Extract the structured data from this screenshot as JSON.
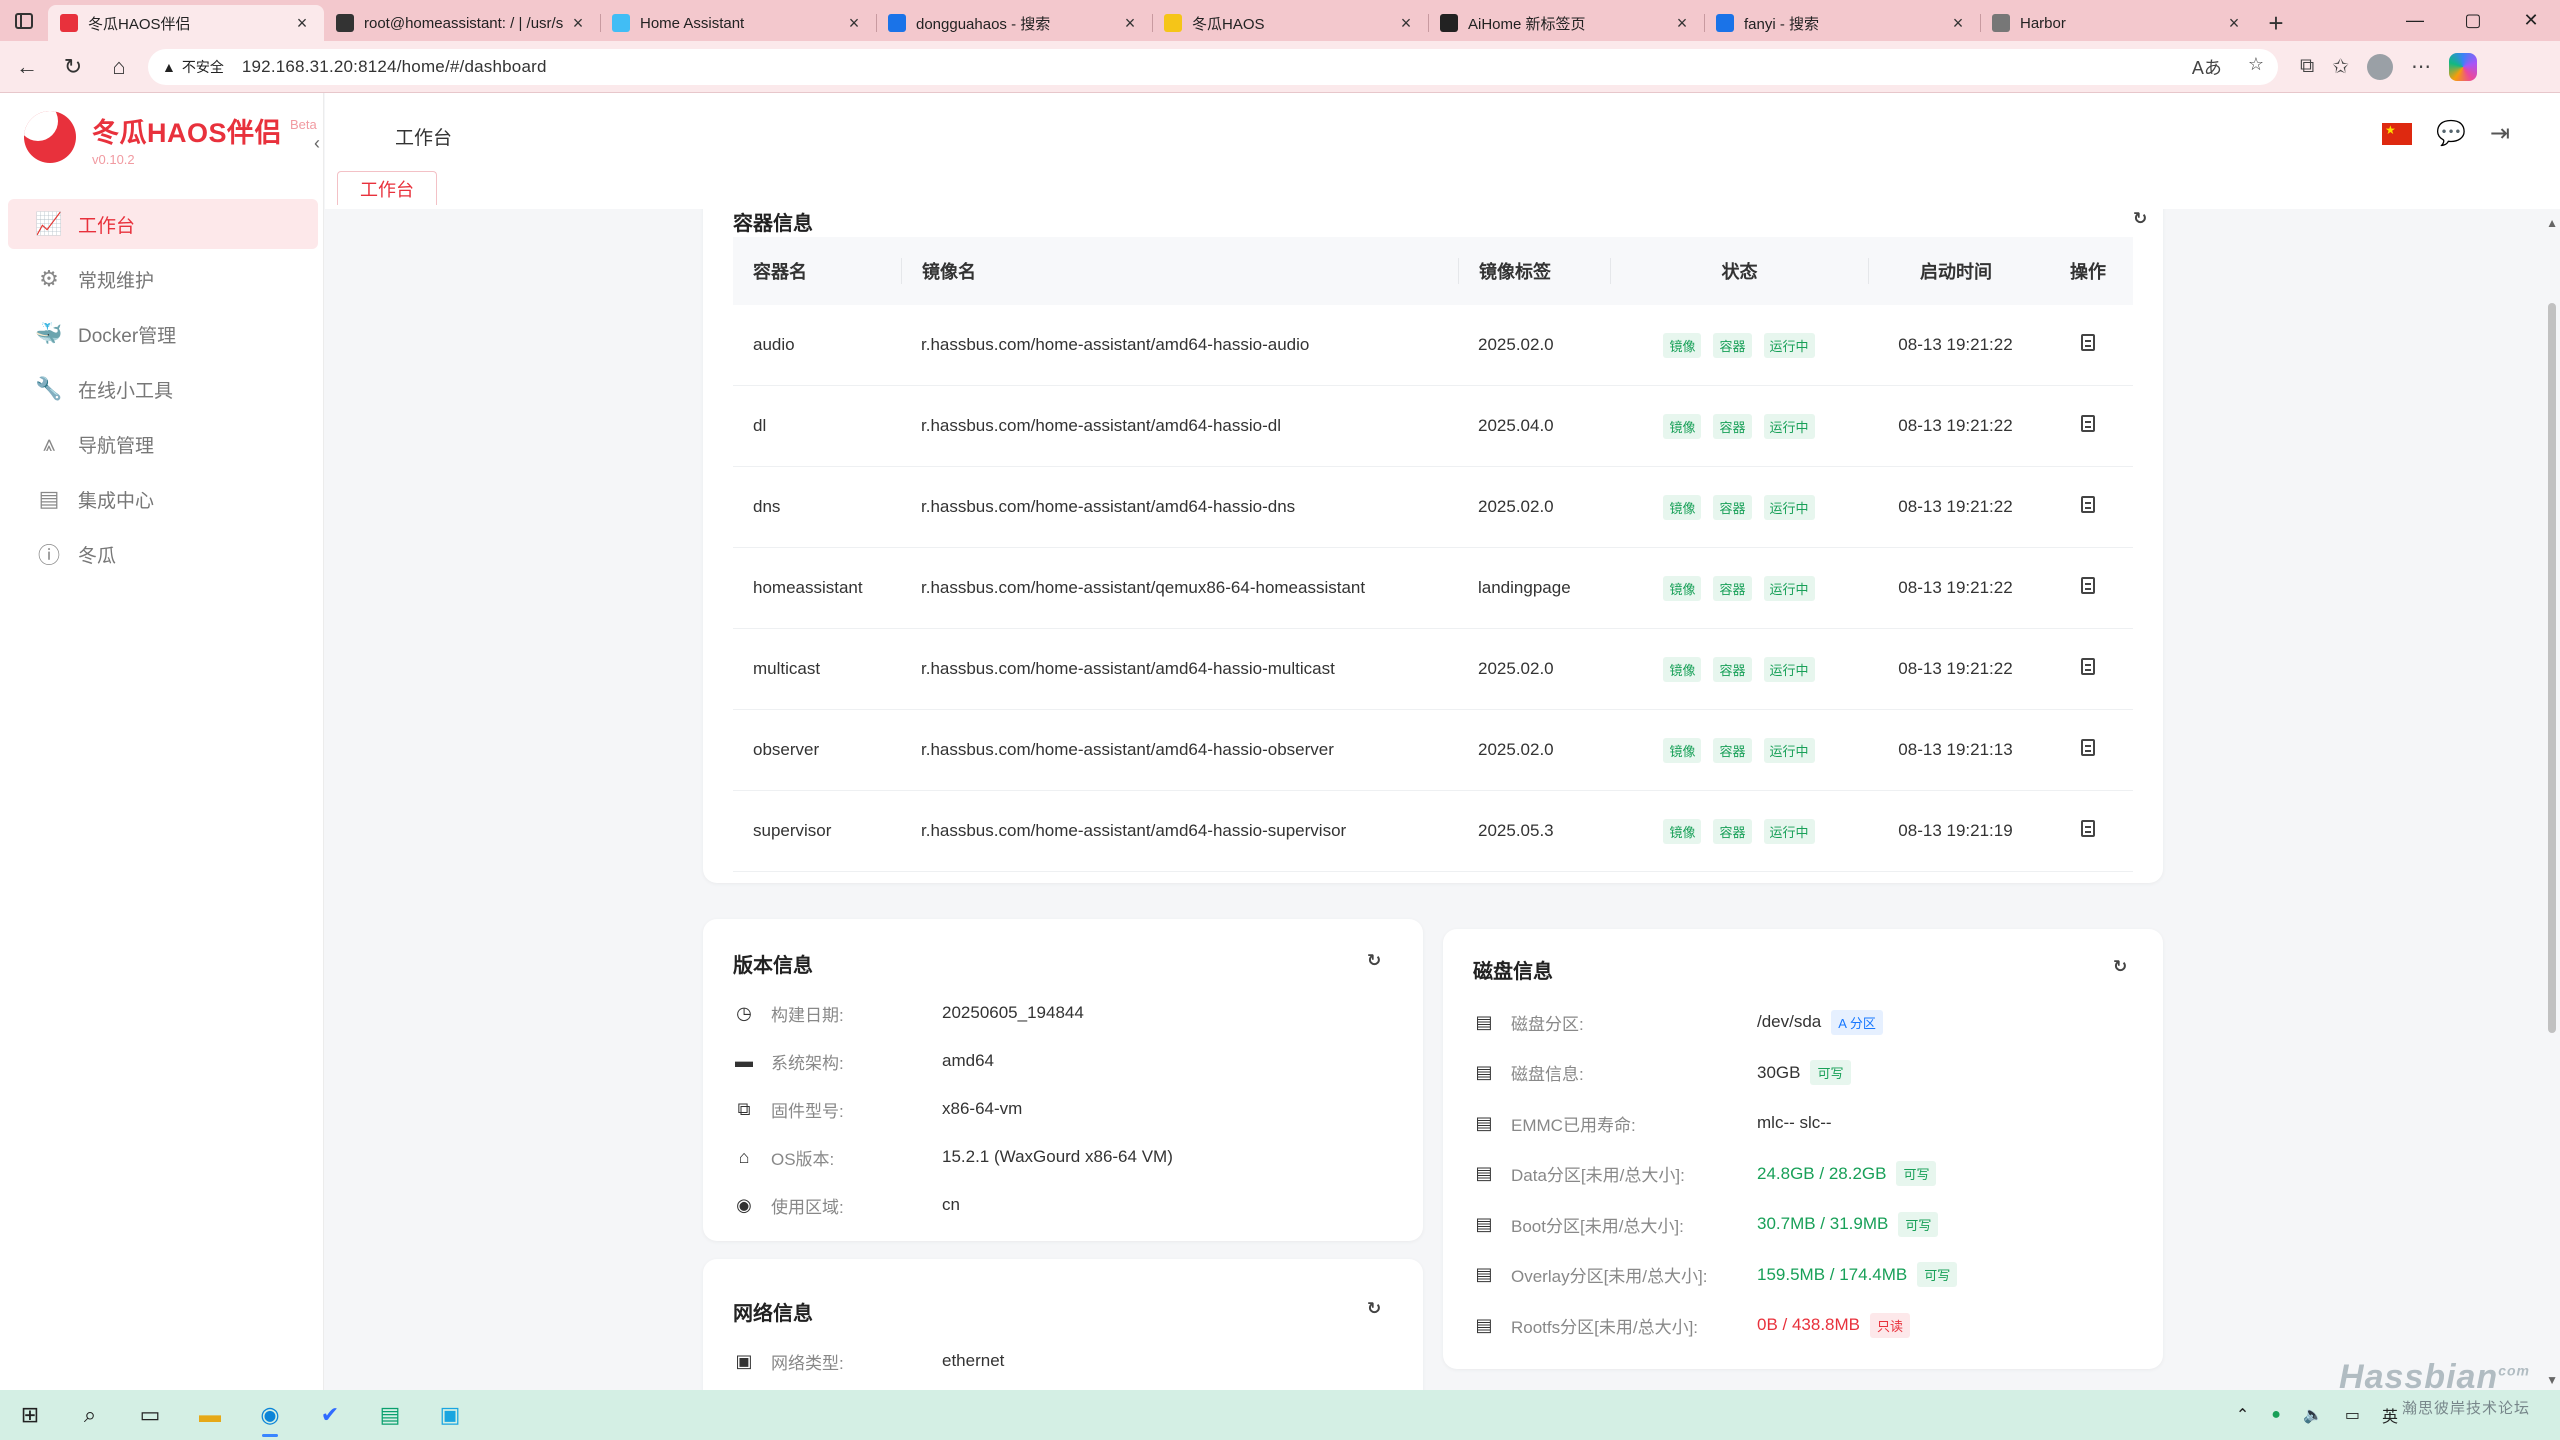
{
  "browser": {
    "tabs": [
      {
        "title": "冬瓜HAOS伴侣",
        "icon": "dongua-icon",
        "color": "#e8313c",
        "active": true
      },
      {
        "title": "root@homeassistant: / | /usr/s",
        "icon": "terminal-icon",
        "color": "#333333",
        "active": false
      },
      {
        "title": "Home Assistant",
        "icon": "home-assistant-icon",
        "color": "#41bdf5",
        "active": false
      },
      {
        "title": "dongguahaos - 搜索",
        "icon": "search-icon",
        "color": "#1a73e8",
        "active": false
      },
      {
        "title": "冬瓜HAOS",
        "icon": "wechat-icon",
        "color": "#f5c518",
        "active": false
      },
      {
        "title": "AiHome 新标签页",
        "icon": "aihome-icon",
        "color": "#222222",
        "active": false
      },
      {
        "title": "fanyi - 搜索",
        "icon": "search-icon",
        "color": "#1a73e8",
        "active": false
      },
      {
        "title": "Harbor",
        "icon": "harbor-icon",
        "color": "#777777",
        "active": false
      }
    ],
    "security_label": "不安全",
    "url": "192.168.31.20:8124/home/#/dashboard"
  },
  "sidebar": {
    "brand_name": "冬瓜HAOS伴侣",
    "beta": "Beta",
    "version": "v0.10.2",
    "items": [
      {
        "label": "工作台",
        "icon": "dashboard-icon",
        "active": true
      },
      {
        "label": "常规维护",
        "icon": "maintenance-icon",
        "active": false
      },
      {
        "label": "Docker管理",
        "icon": "docker-icon",
        "active": false
      },
      {
        "label": "在线小工具",
        "icon": "tools-icon",
        "active": false
      },
      {
        "label": "导航管理",
        "icon": "navigation-icon",
        "active": false
      },
      {
        "label": "集成中心",
        "icon": "integration-icon",
        "active": false
      },
      {
        "label": "冬瓜",
        "icon": "info-icon",
        "active": false
      }
    ]
  },
  "header": {
    "title": "工作台",
    "tag": "工作台"
  },
  "containers": {
    "title": "容器信息",
    "columns": [
      "容器名",
      "镜像名",
      "镜像标签",
      "状态",
      "启动时间",
      "操作"
    ],
    "badges": [
      "镜像",
      "容器",
      "运行中"
    ],
    "rows": [
      {
        "name": "audio",
        "image": "r.hassbus.com/home-assistant/amd64-hassio-audio",
        "tag": "2025.02.0",
        "time": "08-13 19:21:22"
      },
      {
        "name": "dl",
        "image": "r.hassbus.com/home-assistant/amd64-hassio-dl",
        "tag": "2025.04.0",
        "time": "08-13 19:21:22"
      },
      {
        "name": "dns",
        "image": "r.hassbus.com/home-assistant/amd64-hassio-dns",
        "tag": "2025.02.0",
        "time": "08-13 19:21:22"
      },
      {
        "name": "homeassistant",
        "image": "r.hassbus.com/home-assistant/qemux86-64-homeassistant",
        "tag": "landingpage",
        "time": "08-13 19:21:22"
      },
      {
        "name": "multicast",
        "image": "r.hassbus.com/home-assistant/amd64-hassio-multicast",
        "tag": "2025.02.0",
        "time": "08-13 19:21:22"
      },
      {
        "name": "observer",
        "image": "r.hassbus.com/home-assistant/amd64-hassio-observer",
        "tag": "2025.02.0",
        "time": "08-13 19:21:13"
      },
      {
        "name": "supervisor",
        "image": "r.hassbus.com/home-assistant/amd64-hassio-supervisor",
        "tag": "2025.05.3",
        "time": "08-13 19:21:19"
      }
    ]
  },
  "version_info": {
    "title": "版本信息",
    "rows": [
      {
        "label": "构建日期:",
        "value": "20250605_194844",
        "icon": "clock-icon"
      },
      {
        "label": "系统架构:",
        "value": "amd64",
        "icon": "archive-icon"
      },
      {
        "label": "固件型号:",
        "value": "x86-64-vm",
        "icon": "copy-icon"
      },
      {
        "label": "OS版本:",
        "value": "15.2.1 (WaxGourd x86-64 VM)",
        "icon": "house-icon"
      },
      {
        "label": "使用区域:",
        "value": "cn",
        "icon": "location-icon"
      }
    ]
  },
  "network_info": {
    "title": "网络信息",
    "rows": [
      {
        "label": "网络类型:",
        "value": "ethernet",
        "icon": "network-icon"
      }
    ]
  },
  "disk_info": {
    "title": "磁盘信息",
    "rows": [
      {
        "label": "磁盘分区:",
        "value": "/dev/sda",
        "pill": "A 分区",
        "pill_type": "blue",
        "value_color": "normal"
      },
      {
        "label": "磁盘信息:",
        "value": "30GB",
        "pill": "可写",
        "pill_type": "green",
        "value_color": "normal"
      },
      {
        "label": "EMMC已用寿命:",
        "value": "mlc-- slc--",
        "pill": "",
        "pill_type": "",
        "value_color": "normal"
      },
      {
        "label": "Data分区[未用/总大小]:",
        "value": "24.8GB / 28.2GB",
        "pill": "可写",
        "pill_type": "green",
        "value_color": "green"
      },
      {
        "label": "Boot分区[未用/总大小]:",
        "value": "30.7MB / 31.9MB",
        "pill": "可写",
        "pill_type": "green",
        "value_color": "green"
      },
      {
        "label": "Overlay分区[未用/总大小]:",
        "value": "159.5MB / 174.4MB",
        "pill": "可写",
        "pill_type": "green",
        "value_color": "green"
      },
      {
        "label": "Rootfs分区[未用/总大小]:",
        "value": "0B / 438.8MB",
        "pill": "只读",
        "pill_type": "red",
        "value_color": "red"
      }
    ]
  },
  "taskbar": {
    "ime": "英",
    "watermark": "Hassbian",
    "watermark_domain": "com",
    "watermark_sub": "瀚思彼岸技术论坛"
  }
}
